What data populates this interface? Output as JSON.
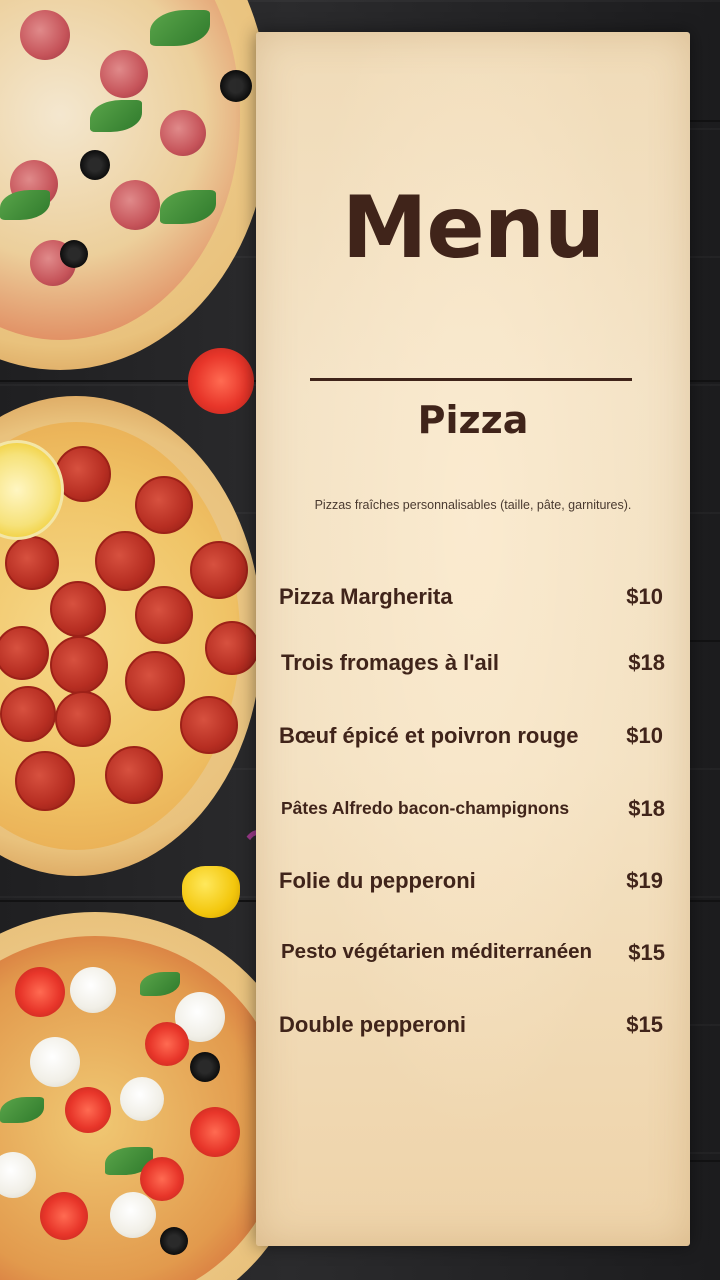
{
  "menu": {
    "title": "Menu",
    "section": "Pizza",
    "description": "Pizzas fraîches personnalisables (taille, pâte, garnitures).",
    "items": [
      {
        "name": "Pizza Margherita",
        "price": "$10"
      },
      {
        "name": "Trois fromages à l'ail",
        "price": "$18"
      },
      {
        "name": "Bœuf épicé et poivron rouge",
        "price": "$10"
      },
      {
        "name": "Pâtes Alfredo bacon-champignons",
        "price": "$18"
      },
      {
        "name": "Folie du pepperoni",
        "price": "$19"
      },
      {
        "name": "Pesto végétarien méditerranéen",
        "price": "$15"
      },
      {
        "name": "Double pepperoni",
        "price": "$15"
      }
    ]
  },
  "colors": {
    "text": "#40241a",
    "paper": "#f4e3c6",
    "background": "#232325"
  }
}
